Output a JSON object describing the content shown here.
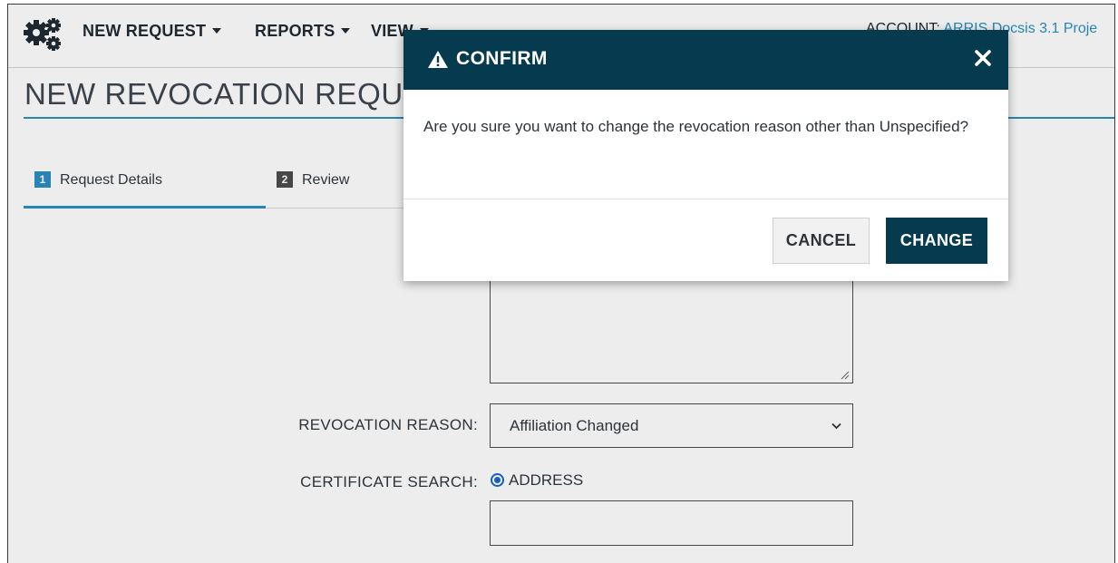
{
  "navbar": {
    "logo_icon": "gears-icon",
    "menus": [
      {
        "label": "NEW REQUEST"
      },
      {
        "label": "REPORTS"
      },
      {
        "label": "VIEW"
      }
    ],
    "account_label": "ACCOUNT:",
    "account_value": "ARRIS Docsis 3.1 Proje"
  },
  "page": {
    "title": "NEW REVOCATION REQUE"
  },
  "steps": [
    {
      "number": "1",
      "label": "Request Details",
      "active": true
    },
    {
      "number": "2",
      "label": "Review",
      "active": false
    }
  ],
  "form": {
    "revocation_reason_label": "REVOCATION REASON:",
    "revocation_reason_value": "Affiliation Changed",
    "certificate_search_label": "CERTIFICATE SEARCH:",
    "certificate_search_option": "ADDRESS",
    "certificate_search_selected": true
  },
  "modal": {
    "icon": "warning-icon",
    "title": "CONFIRM",
    "close_icon": "close-icon",
    "message": "Are you sure you want to change the revocation reason other than Unspecified?",
    "cancel_label": "CANCEL",
    "confirm_label": "CHANGE"
  },
  "colors": {
    "brand_dark": "#063a4f",
    "accent_blue": "#2b8fc2",
    "radio_blue": "#1a66c9",
    "text_dark": "#303840"
  }
}
